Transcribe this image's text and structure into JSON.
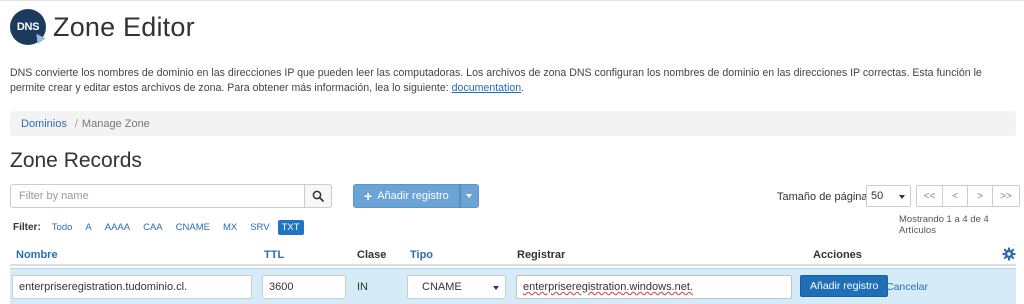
{
  "header": {
    "logo_text": "DNS",
    "title": "Zone Editor"
  },
  "description": {
    "text": "DNS convierte los nombres de dominio en las direcciones IP que pueden leer las computadoras. Los archivos de zona DNS configuran los nombres de dominio en las direcciones IP correctas. Esta función le permite crear y editar estos archivos de zona. Para obtener más información, lea lo siguiente: ",
    "link_text": "documentation",
    "end": "."
  },
  "breadcrumb": {
    "parent": "Dominios",
    "separator": "/",
    "current": "Manage Zone"
  },
  "section_title": "Zone Records",
  "filter_input": {
    "placeholder": "Filter by name",
    "value": ""
  },
  "add_button": {
    "label": "Añadir registro"
  },
  "page_size": {
    "label": "Tamaño de página",
    "value": "50"
  },
  "pager": {
    "first": "<<",
    "prev": "<",
    "next": ">",
    "last": ">>"
  },
  "showing": "Mostrando 1 a 4 de 4 Artículos",
  "filters": {
    "label": "Filter:",
    "chips": [
      "Todo",
      "A",
      "AAAA",
      "CAA",
      "CNAME",
      "MX",
      "SRV",
      "TXT"
    ],
    "active": "TXT"
  },
  "table": {
    "columns": {
      "name": "Nombre",
      "ttl": "TTL",
      "class": "Clase",
      "type": "Tipo",
      "record": "Registrar",
      "actions": "Acciones"
    }
  },
  "edit_row": {
    "name": "enterpriseregistration.tudominio.cl.",
    "ttl": "3600",
    "class": "IN",
    "type": "CNAME",
    "record": "enterpriseregistration.windows.net.",
    "save_label": "Añadir registro",
    "cancel_label": "Cancelar"
  },
  "colors": {
    "link": "#2a6db0",
    "primary_button": "#1f6fb8",
    "add_button": "#6ba3d6",
    "edit_row_bg": "#d6ebf8",
    "active_chip": "#1f75c2"
  }
}
